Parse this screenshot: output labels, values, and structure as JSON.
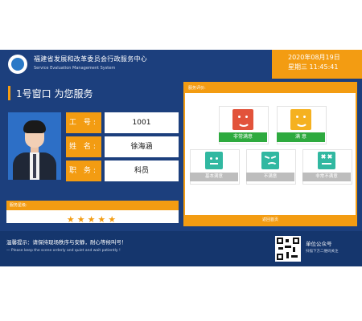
{
  "header": {
    "org_name_cn": "福建省发展和改革委员会行政服务中心",
    "org_name_en": "Service Evaluation Management System",
    "date": "2020年08月19日",
    "weekday_time": "星期三 11:45:41"
  },
  "window": {
    "title": "1号窗口 为您服务"
  },
  "staff": {
    "job_no_label": "工 号:",
    "job_no": "1001",
    "name_label": "姓 名:",
    "name": "徐海涵",
    "position_label": "职 务:",
    "position": "科员"
  },
  "rating": {
    "label": "服务星级:",
    "stars": "★★★★★",
    "value": 5
  },
  "evaluation": {
    "header": "服务评价:",
    "footer": "返回首页",
    "options": [
      {
        "label": "非常满意",
        "color": "#e2533b",
        "label_color": "#2eaa3f"
      },
      {
        "label": "满 意",
        "color": "#f5b120",
        "label_color": "#2eaa3f"
      },
      {
        "label": "基本满意",
        "color": "#31b8a1",
        "label_color": "#bdbdbd"
      },
      {
        "label": "不满意",
        "color": "#31b8a1",
        "label_color": "#bdbdbd"
      },
      {
        "label": "非常不满意",
        "color": "#31b8a1",
        "label_color": "#bdbdbd"
      }
    ]
  },
  "footer": {
    "tip_cn": "温馨提示：请保持现场秩序与安静，耐心等候叫号！",
    "tip_en": "— Please keep the scene orderly and quiet and wait patiently !",
    "account_title": "单位公众号",
    "account_sub": "扫描下方二维码关注"
  },
  "colors": {
    "primary_blue": "#1c3f7d",
    "accent_orange": "#f39c12"
  }
}
